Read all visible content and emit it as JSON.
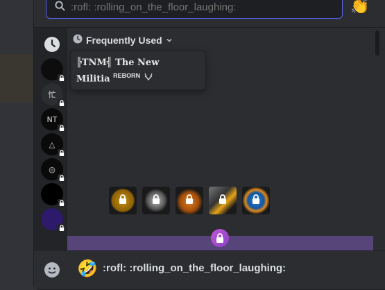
{
  "search": {
    "placeholder": ":rofl: :rolling_on_the_floor_laughing:",
    "value": "",
    "emoji_button": "👏"
  },
  "sidebar": {
    "recent_icon": "clock-icon",
    "servers": [
      {
        "label": "",
        "locked": true,
        "color": "#0d0d0d"
      },
      {
        "label": "忙",
        "locked": true,
        "color": "#2b2d31"
      },
      {
        "label": "NT",
        "locked": true,
        "color": "#0a0a0a"
      },
      {
        "label": "△",
        "locked": true,
        "color": "#0a0a0a"
      },
      {
        "label": "◎",
        "locked": true,
        "color": "#0a0a0a"
      },
      {
        "label": "",
        "locked": true,
        "color": "#000000"
      },
      {
        "label": "",
        "locked": true,
        "color": "#2d1a6b"
      }
    ]
  },
  "section": {
    "title": "Frequently Used"
  },
  "tooltip": {
    "line1": "╠TNM╣ The New",
    "line2": "Militia",
    "suffix": "REBORN"
  },
  "emojis": [
    {
      "name": "locked-emoji-1",
      "locked": true
    },
    {
      "name": "locked-emoji-2",
      "locked": true
    },
    {
      "name": "locked-emoji-3",
      "locked": true
    },
    {
      "name": "locked-emoji-4",
      "locked": true
    },
    {
      "name": "locked-emoji-5",
      "locked": true
    }
  ],
  "footer": {
    "preview_emoji": "🤣",
    "preview_text": ":rofl: :rolling_on_the_floor_laughing:"
  },
  "colors": {
    "accent": "#5865f2",
    "premium_bar": "#574478",
    "premium_lock": "#b450d4"
  }
}
